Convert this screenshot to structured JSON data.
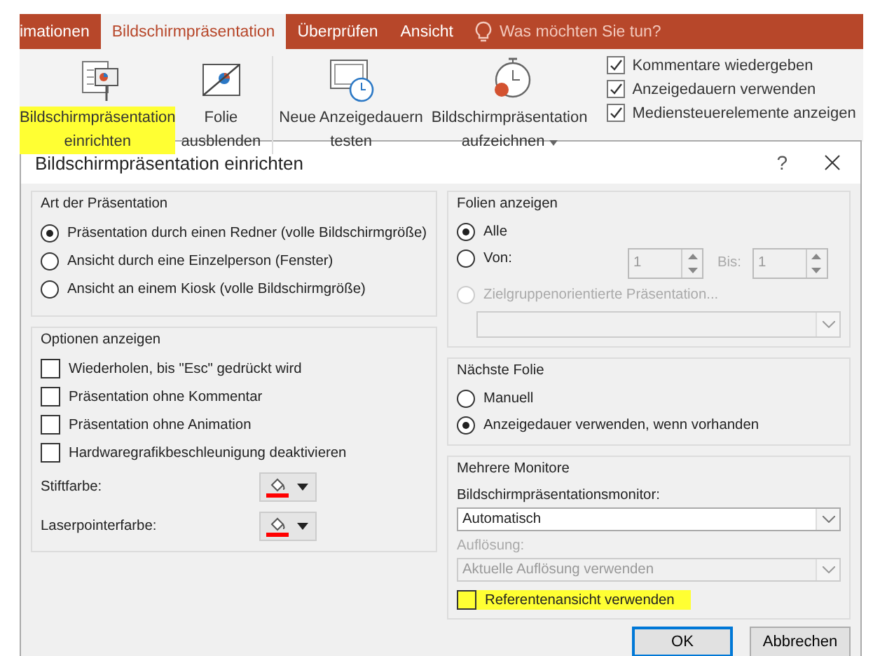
{
  "ribbon": {
    "tabs": [
      {
        "label": "imationen",
        "selected": false
      },
      {
        "label": "Bildschirmpräsentation",
        "selected": true
      },
      {
        "label": "Überprüfen",
        "selected": false
      },
      {
        "label": "Ansicht",
        "selected": false
      }
    ],
    "tell_me": "Was möchten Sie tun?",
    "commands": [
      {
        "kind": "setup",
        "lines": [
          "Bildschirmpräsentation",
          "einrichten"
        ],
        "highlighted": true,
        "dropdown": false
      },
      {
        "kind": "hide",
        "lines": [
          "Folie",
          "ausblenden"
        ],
        "highlighted": false,
        "dropdown": false
      },
      {
        "kind": "rehearse",
        "lines": [
          "Neue Anzeigedauern",
          "testen"
        ],
        "highlighted": false,
        "dropdown": false
      },
      {
        "kind": "record",
        "lines": [
          "Bildschirmpräsentation",
          "aufzeichnen"
        ],
        "highlighted": false,
        "dropdown": true
      }
    ],
    "options": [
      {
        "label": "Kommentare wiedergeben",
        "checked": true
      },
      {
        "label": "Anzeigedauern verwenden",
        "checked": true
      },
      {
        "label": "Mediensteuerelemente anzeigen",
        "checked": true
      }
    ]
  },
  "dialog": {
    "title": "Bildschirmpräsentation einrichten",
    "help": "?",
    "art": {
      "title": "Art der Präsentation",
      "options": [
        {
          "label": "Präsentation durch einen Redner (volle Bildschirmgröße)",
          "selected": true
        },
        {
          "label": "Ansicht durch eine Einzelperson (Fenster)",
          "selected": false
        },
        {
          "label": "Ansicht an einem Kiosk (volle Bildschirmgröße)",
          "selected": false
        }
      ]
    },
    "optionen": {
      "title": "Optionen anzeigen",
      "checkboxes": [
        {
          "label": "Wiederholen, bis \"Esc\" gedrückt wird",
          "checked": false
        },
        {
          "label": "Präsentation ohne Kommentar",
          "checked": false
        },
        {
          "label": "Präsentation ohne Animation",
          "checked": false
        },
        {
          "label": "Hardwaregrafikbeschleunigung deaktivieren",
          "checked": false
        }
      ],
      "colors": [
        {
          "label": "Stiftfarbe:",
          "color": "#ff0000"
        },
        {
          "label": "Laserpointerfarbe:",
          "color": "#ff0000"
        }
      ]
    },
    "folien": {
      "title": "Folien anzeigen",
      "all": {
        "label": "Alle",
        "selected": true
      },
      "range": {
        "label": "Von:",
        "selected": false,
        "from": "1",
        "to_label": "Bis:",
        "to": "1"
      },
      "custom": {
        "label": "Zielgruppenorientierte Präsentation...",
        "selected": false,
        "disabled": true
      }
    },
    "naechste": {
      "title": "Nächste Folie",
      "options": [
        {
          "label": "Manuell",
          "selected": false
        },
        {
          "label": "Anzeigedauer verwenden, wenn vorhanden",
          "selected": true
        }
      ]
    },
    "monitore": {
      "title": "Mehrere Monitore",
      "monitor_label": "Bildschirmpräsentationsmonitor:",
      "monitor_value": "Automatisch",
      "resolution_label": "Auflösung:",
      "resolution_value": "Aktuelle Auflösung verwenden",
      "resolution_disabled": true,
      "presenter": {
        "label": "Referentenansicht verwenden",
        "checked": false,
        "highlighted": true
      }
    },
    "buttons": [
      {
        "label": "OK",
        "default": true
      },
      {
        "label": "Abbrechen",
        "default": false
      }
    ]
  }
}
